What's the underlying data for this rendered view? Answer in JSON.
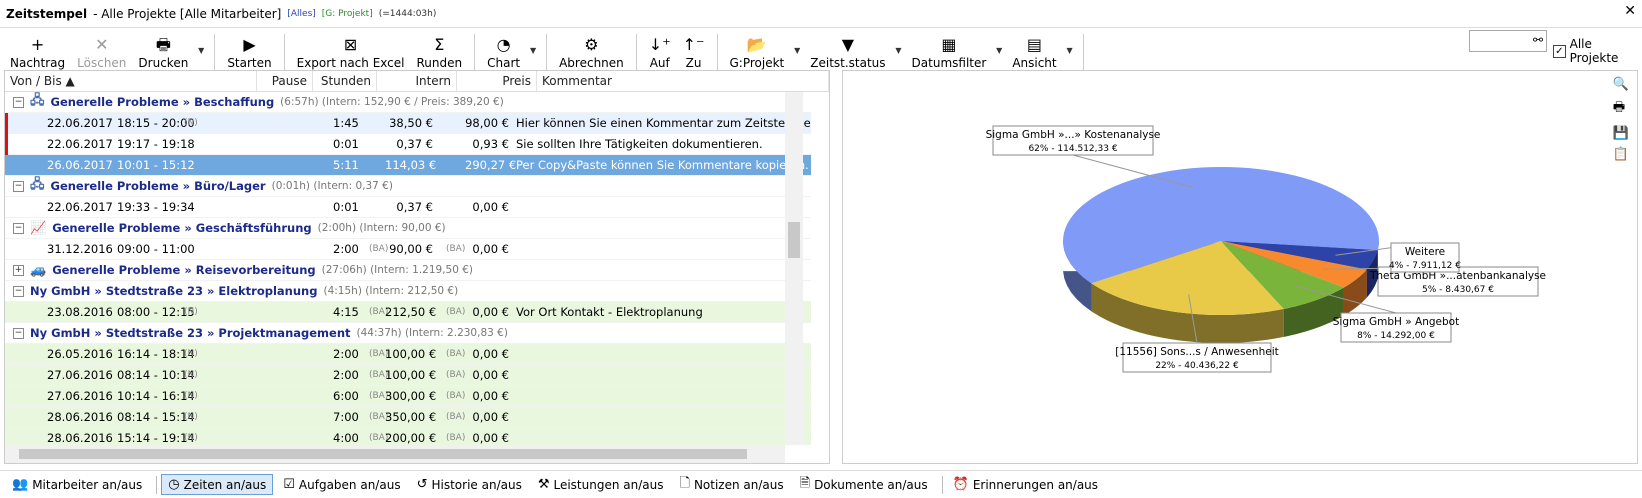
{
  "titlebar": {
    "title": "Zeitstempel",
    "subtitle": "- Alle Projekte [Alle Mitarbeiter]",
    "badge_all": "[Alles]",
    "badge_project": "[G: Projekt]",
    "badge_total": "(=1444:03h)"
  },
  "toolbar": {
    "items": [
      {
        "label": "Nachtrag",
        "icon": "+",
        "name": "nachtrag-button",
        "disabled": false
      },
      {
        "label": "Löschen",
        "icon": "✕",
        "name": "loeschen-button",
        "disabled": true
      },
      {
        "label": "Drucken",
        "icon": "🖶",
        "name": "drucken-button",
        "disabled": false,
        "dd": true
      },
      {
        "label": "Starten",
        "icon": "▶",
        "name": "starten-button",
        "disabled": false
      },
      {
        "label": "Export nach Excel",
        "icon": "⊠",
        "name": "export-excel-button",
        "disabled": false
      },
      {
        "label": "Runden",
        "icon": "Σ",
        "name": "runden-button",
        "disabled": false
      },
      {
        "label": "Chart",
        "icon": "◔",
        "name": "chart-button",
        "disabled": false,
        "dd": true
      },
      {
        "label": "Abrechnen",
        "icon": "⚙",
        "name": "abrechnen-button",
        "disabled": false
      },
      {
        "label": "Auf",
        "icon": "↓⁺",
        "name": "sort-auf-button",
        "disabled": false
      },
      {
        "label": "Zu",
        "icon": "↑⁻",
        "name": "sort-zu-button",
        "disabled": false
      },
      {
        "label": "G:Projekt",
        "icon": "📂",
        "name": "gprojekt-button",
        "disabled": false,
        "dd": true
      },
      {
        "label": "Zeitst.status",
        "icon": "▼",
        "name": "zeitstatus-button",
        "disabled": false,
        "dd": true
      },
      {
        "label": "Datumsfilter",
        "icon": "▦",
        "name": "datumsfilter-button",
        "disabled": false,
        "dd": true
      },
      {
        "label": "Ansicht",
        "icon": "▤",
        "name": "ansicht-button",
        "disabled": false,
        "dd": true
      }
    ]
  },
  "search": {
    "value": ""
  },
  "all_projects": {
    "label": "Alle Projekte",
    "checked": "✓"
  },
  "table": {
    "headers": [
      "Von / Bis",
      "Pause",
      "Stunden",
      "Intern",
      "Preis",
      "Kommentar"
    ],
    "rows": [
      {
        "type": "group",
        "icon": "🖧",
        "label": "Generelle Probleme » Beschaffung",
        "ext": "(6:57h) (Intern: 152,90 € / Preis: 389,20 €)"
      },
      {
        "type": "item",
        "date": "22.06.2017",
        "time": "18:15 - 20:00",
        "flag": "(N)",
        "hours": "1:45",
        "bh": "",
        "intern": "38,50 €",
        "bi": "",
        "preis": "98,00 €",
        "kommentar": "Hier können Sie einen Kommentar zum Zeitstempel",
        "style": "hl",
        "red": true
      },
      {
        "type": "item",
        "date": "22.06.2017",
        "time": "19:17 - 19:18",
        "flag": "",
        "hours": "0:01",
        "bh": "",
        "intern": "0,37 €",
        "bi": "",
        "preis": "0,93 €",
        "kommentar": "Sie sollten Ihre Tätigkeiten dokumentieren.",
        "style": "",
        "red": true
      },
      {
        "type": "item",
        "date": "26.06.2017",
        "time": "10:01 - 15:12",
        "flag": "",
        "hours": "5:11",
        "bh": "",
        "intern": "114,03 €",
        "bi": "",
        "preis": "290,27 €",
        "kommentar": "Per Copy&Paste können Sie Kommentare kopieren.",
        "style": "sel",
        "red": false
      },
      {
        "type": "group",
        "icon": "🖧",
        "label": "Generelle Probleme » Büro/Lager",
        "ext": "(0:01h) (Intern: 0,37 €)"
      },
      {
        "type": "item",
        "date": "22.06.2017",
        "time": "19:33 - 19:34",
        "flag": "",
        "hours": "0:01",
        "bh": "",
        "intern": "0,37 €",
        "bi": "",
        "preis": "0,00 €",
        "kommentar": "",
        "style": "",
        "red": false
      },
      {
        "type": "group",
        "icon": "📈",
        "label": "Generelle Probleme » Geschäftsführung",
        "ext": "(2:00h) (Intern: 90,00 €)"
      },
      {
        "type": "item",
        "date": "31.12.2016",
        "time": "09:00 - 11:00",
        "flag": "",
        "hours": "2:00",
        "bh": "(BA)",
        "intern": "90,00 €",
        "bi": "(BA)",
        "preis": "0,00 €",
        "kommentar": "",
        "style": "",
        "red": false
      },
      {
        "type": "group",
        "icon": "🚙",
        "label": "Generelle Probleme » Reisevorbereitung",
        "ext": "(27:06h) (Intern: 1.219,50 €)",
        "collapsed": true
      },
      {
        "type": "group",
        "icon": "",
        "label": "Ny GmbH » Stedtstraße 23 » Elektroplanung",
        "ext": "(4:15h) (Intern: 212,50 €)"
      },
      {
        "type": "item",
        "date": "23.08.2016",
        "time": "08:00 - 12:15",
        "flag": "(N)",
        "hours": "4:15",
        "bh": "(BA)",
        "intern": "212,50 €",
        "bi": "(BA)",
        "preis": "0,00 €",
        "kommentar": "Vor Ort Kontakt - Elektroplanung",
        "style": "green",
        "red": false
      },
      {
        "type": "group",
        "icon": "",
        "label": "Ny GmbH » Stedtstraße 23 » Projektmanagement",
        "ext": "(44:37h) (Intern: 2.230,83 €)"
      },
      {
        "type": "item",
        "date": "26.05.2016",
        "time": "16:14 - 18:14",
        "flag": "(N)",
        "hours": "2:00",
        "bh": "(BA)",
        "intern": "100,00 €",
        "bi": "(BA)",
        "preis": "0,00 €",
        "kommentar": "",
        "style": "green",
        "red": false
      },
      {
        "type": "item",
        "date": "27.06.2016",
        "time": "08:14 - 10:14",
        "flag": "(N)",
        "hours": "2:00",
        "bh": "(BA)",
        "intern": "100,00 €",
        "bi": "(BA)",
        "preis": "0,00 €",
        "kommentar": "",
        "style": "green",
        "red": false
      },
      {
        "type": "item",
        "date": "27.06.2016",
        "time": "10:14 - 16:14",
        "flag": "(N)",
        "hours": "6:00",
        "bh": "(BA)",
        "intern": "300,00 €",
        "bi": "(BA)",
        "preis": "0,00 €",
        "kommentar": "",
        "style": "green",
        "red": false
      },
      {
        "type": "item",
        "date": "28.06.2016",
        "time": "08:14 - 15:14",
        "flag": "(N)",
        "hours": "7:00",
        "bh": "(BA)",
        "intern": "350,00 €",
        "bi": "(BA)",
        "preis": "0,00 €",
        "kommentar": "",
        "style": "green",
        "red": false
      },
      {
        "type": "item",
        "date": "28.06.2016",
        "time": "15:14 - 19:14",
        "flag": "(N)",
        "hours": "4:00",
        "bh": "(BA)",
        "intern": "200,00 €",
        "bi": "(BA)",
        "preis": "0,00 €",
        "kommentar": "",
        "style": "green",
        "red": false
      }
    ]
  },
  "chart_data": {
    "type": "pie",
    "slices": [
      {
        "label": "Sigma GmbH »...» Kostenanalyse",
        "detail": "62% - 114.512,33 €",
        "value": 114512.33,
        "color": "#7f9bf7"
      },
      {
        "label": "[11556] Sons...s / Anwesenheit",
        "detail": "22% - 40.436,22 €",
        "value": 40436.22,
        "color": "#e8ca48"
      },
      {
        "label": "Sigma GmbH » Angebot",
        "detail": "8% - 14.292,00 €",
        "value": 14292.0,
        "color": "#7bb43b"
      },
      {
        "label": "Theta GmbH »...atenbankanalyse",
        "detail": "5% - 8.430,67 €",
        "value": 8430.67,
        "color": "#f7892e"
      },
      {
        "label": "Weitere",
        "detail": "4% - 7.911,12 €",
        "value": 7911.12,
        "color": "#2e43a8"
      }
    ]
  },
  "bottombar": {
    "items": [
      {
        "label": "Mitarbeiter an/aus",
        "icon": "👥",
        "name": "mitarbeiter-toggle",
        "active": false
      },
      {
        "label": "Zeiten an/aus",
        "icon": "◷",
        "name": "zeiten-toggle",
        "active": true
      },
      {
        "label": "Aufgaben an/aus",
        "icon": "☑",
        "name": "aufgaben-toggle",
        "active": false
      },
      {
        "label": "Historie an/aus",
        "icon": "↺",
        "name": "historie-toggle",
        "active": false
      },
      {
        "label": "Leistungen an/aus",
        "icon": "⚒",
        "name": "leistungen-toggle",
        "active": false
      },
      {
        "label": "Notizen an/aus",
        "icon": "🗋",
        "name": "notizen-toggle",
        "active": false
      },
      {
        "label": "Dokumente an/aus",
        "icon": "🗎",
        "name": "dokumente-toggle",
        "active": false
      },
      {
        "label": "Erinnerungen an/aus",
        "icon": "⏰",
        "name": "erinnerungen-toggle",
        "active": false
      }
    ]
  }
}
